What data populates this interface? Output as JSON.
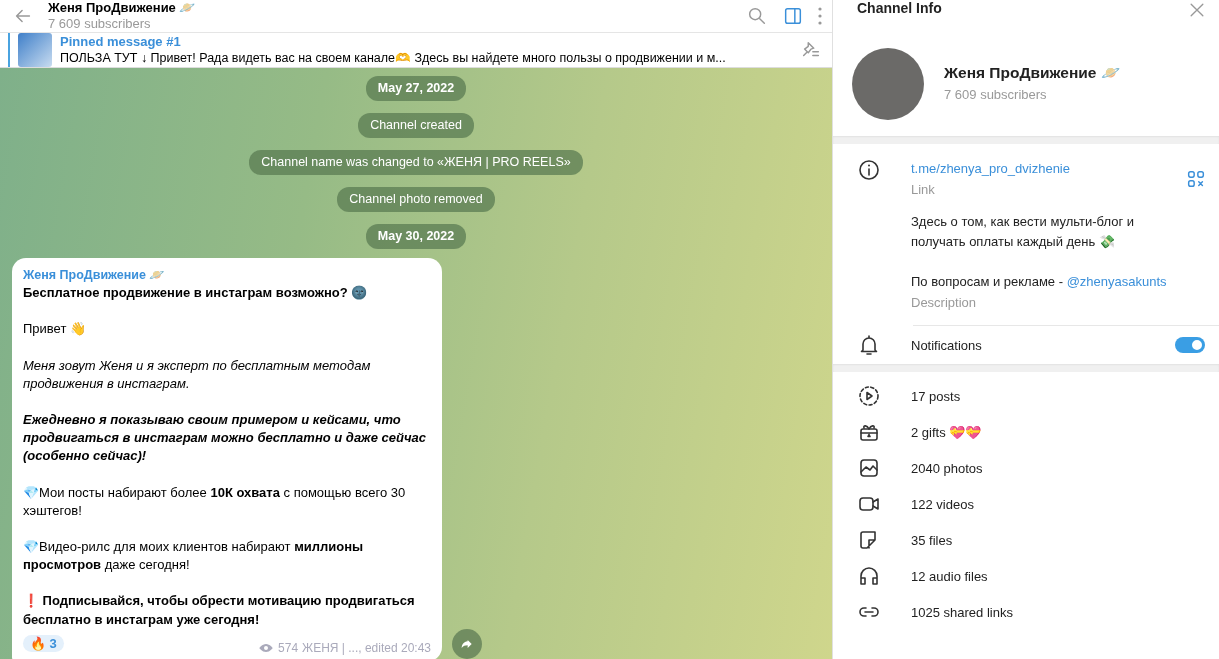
{
  "chat": {
    "title": "Женя ПроДвижение 🪐",
    "subtitle": "7 609 subscribers",
    "side_panel_open": true,
    "pinned": {
      "label": "Pinned message #1",
      "text": "ПОЛЬЗА ТУТ ↓  Привет! Рада видеть вас на своем канале🫶 Здесь вы найдете много пользы о продвижении и м..."
    },
    "service": [
      {
        "kind": "date",
        "text": "May 27, 2022"
      },
      {
        "kind": "event",
        "text": "Channel created"
      },
      {
        "kind": "event",
        "text": "Channel name was changed to «ЖЕНЯ | PRO REELS»"
      },
      {
        "kind": "event",
        "text": "Channel photo removed"
      },
      {
        "kind": "date",
        "text": "May 30, 2022"
      }
    ],
    "message": {
      "author": "Женя ПроДвижение 🪐",
      "paragraphs": [
        {
          "kind": "bold",
          "text": "Бесплатное продвижение в инстаграм возможно? 🌚"
        },
        {
          "kind": "plain",
          "text": "Привет 👋"
        },
        {
          "kind": "italic",
          "text": "Меня зовут Женя и я эксперт по бесплатным методам продвижения в инстаграм."
        },
        {
          "kind": "bold_italic",
          "text": "Ежедневно я показываю своим примером и кейсами, что продвигаться в инстаграм можно бесплатно и даже сейчас (особенно сейчас)!"
        },
        {
          "kind": "plain",
          "text": "💎Мои посты набирают более **10К охвата** с помощью всего 30 хэштегов!"
        },
        {
          "kind": "plain",
          "text": "💎Видео-рилс для моих клиентов набирают **миллионы просмотров** даже сегодня!"
        },
        {
          "kind": "bold",
          "text": "❗️ Подписывайся, чтобы обрести мотивацию продвигаться бесплатно в инстаграм уже сегодня!"
        }
      ],
      "reaction": {
        "emoji": "🔥",
        "count": "3"
      },
      "views": "574",
      "signature": "ЖЕНЯ | ..., edited 20:43"
    }
  },
  "info": {
    "title": "Channel Info",
    "name": "Женя ПроДвижение 🪐",
    "subscribers": "7 609 subscribers",
    "link": "t.me/zhenya_pro_dvizhenie",
    "link_label": "Link",
    "description": "Здесь о том, как вести мульти-блог и\nполучать оплаты каждый день 💸\n\nПо вопросам и рекламе - ",
    "mention": "@zhenyasakunts",
    "description_label": "Description",
    "notifications": {
      "label": "Notifications",
      "on": true
    },
    "media": [
      {
        "kind": "posts",
        "text": "17 posts"
      },
      {
        "kind": "gifts",
        "text": "2 gifts 💝💝"
      },
      {
        "kind": "photos",
        "text": "2040 photos"
      },
      {
        "kind": "videos",
        "text": "122 videos"
      },
      {
        "kind": "files",
        "text": "35 files"
      },
      {
        "kind": "audio",
        "text": "12 audio files"
      },
      {
        "kind": "links",
        "text": "1025 shared links"
      }
    ]
  }
}
